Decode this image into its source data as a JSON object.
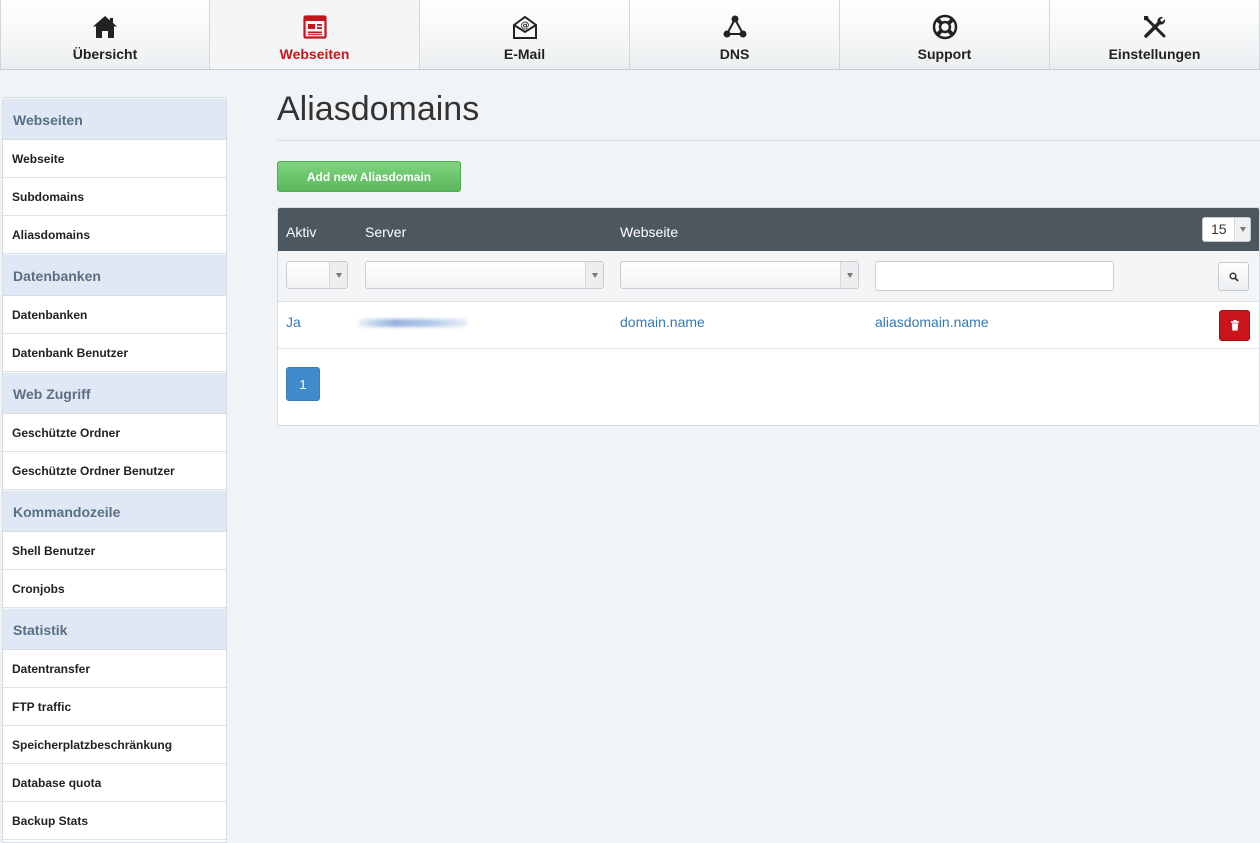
{
  "nav": {
    "items": [
      {
        "label": "Übersicht",
        "icon": "home-icon"
      },
      {
        "label": "Webseiten",
        "icon": "website-icon"
      },
      {
        "label": "E-Mail",
        "icon": "email-icon"
      },
      {
        "label": "DNS",
        "icon": "dns-icon"
      },
      {
        "label": "Support",
        "icon": "lifebuoy-icon"
      },
      {
        "label": "Einstellungen",
        "icon": "tools-icon"
      }
    ],
    "active": "Webseiten",
    "active_color": "#c4161c"
  },
  "sidebar": {
    "groups": [
      {
        "header": "Webseiten",
        "items": [
          "Webseite",
          "Subdomains",
          "Aliasdomains"
        ]
      },
      {
        "header": "Datenbanken",
        "items": [
          "Datenbanken",
          "Datenbank Benutzer"
        ]
      },
      {
        "header": "Web Zugriff",
        "items": [
          "Geschützte Ordner",
          "Geschützte Ordner Benutzer"
        ]
      },
      {
        "header": "Kommandozeile",
        "items": [
          "Shell Benutzer",
          "Cronjobs"
        ]
      },
      {
        "header": "Statistik",
        "items": [
          "Datentransfer",
          "FTP traffic",
          "Speicherplatzbeschränkung",
          "Database quota",
          "Backup Stats"
        ]
      }
    ]
  },
  "main": {
    "title": "Aliasdomains",
    "add_button": "Add new Aliasdomain",
    "table": {
      "columns": [
        "Aktiv",
        "Server",
        "Webseite"
      ],
      "per_page": "15",
      "filter_text_value": "",
      "rows": [
        {
          "aktiv": "Ja",
          "server": "",
          "webseite": "domain.name",
          "aliasdomain": "aliasdomain.name"
        }
      ]
    },
    "pagination": {
      "current": "1"
    }
  },
  "colors": {
    "accent_green": "#5cb85c",
    "table_header": "#4d5760",
    "link_blue": "#337ab7",
    "danger_red": "#c9141b",
    "pagination_blue": "#428bca"
  }
}
